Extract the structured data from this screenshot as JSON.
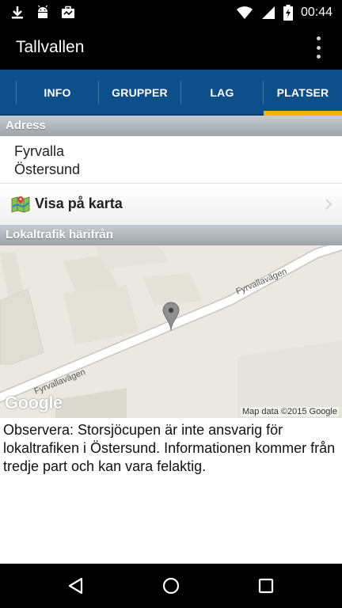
{
  "status_bar": {
    "time": "00:44",
    "left_icons": [
      "download-icon",
      "android-icon",
      "briefcase-icon"
    ],
    "right_icons": [
      "wifi-icon",
      "signal-icon",
      "battery-charging-icon"
    ]
  },
  "app_bar": {
    "title": "Tallvallen",
    "overflow_icon": "more-vertical-icon"
  },
  "tabs": [
    {
      "label": "INFO",
      "selected": false
    },
    {
      "label": "GRUPPER",
      "selected": false
    },
    {
      "label": "LAG",
      "selected": false
    },
    {
      "label": "PLATSER",
      "selected": true
    }
  ],
  "colors": {
    "tab_bar": "#0d4f8b",
    "tab_indicator": "#f5b400",
    "section_header": "#aeb3b8"
  },
  "address_section": {
    "header": "Adress",
    "line1": "Fyrvalla",
    "line2": "Östersund"
  },
  "map_link": {
    "icon": "map-icon",
    "label": "Visa på karta"
  },
  "traffic_section": {
    "header": "Lokaltrafik härifrån"
  },
  "map": {
    "road_label_1": "Fyrvallavägen",
    "road_label_2": "Fyrvallavägen",
    "logo": "Google",
    "credit": "Map data ©2015 Google"
  },
  "notice": "Observera: Storsjöcupen är inte ansvarig för lokaltrafiken i Östersund. Informationen kommer från tredje part och kan vara felaktig.",
  "nav_bar": {
    "buttons": [
      "back-icon",
      "home-icon",
      "recents-icon"
    ]
  }
}
